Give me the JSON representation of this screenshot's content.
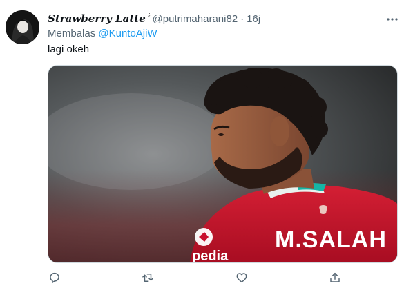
{
  "tweet": {
    "author": {
      "display_name": "Strawberry Latte",
      "name_emoji": "ᵕ̈",
      "handle": "@putrimaharani82",
      "separator": "·",
      "time": "16j"
    },
    "reply_context": {
      "prefix": "Membalas",
      "mention": "@KuntoAjiW"
    },
    "text": "lagi okeh",
    "media": {
      "jersey_name": "M.SALAH",
      "sponsor_text": "pedia"
    },
    "actions": [
      {
        "name": "reply",
        "icon": "reply-icon"
      },
      {
        "name": "retweet",
        "icon": "retweet-icon"
      },
      {
        "name": "like",
        "icon": "heart-icon"
      },
      {
        "name": "share",
        "icon": "share-icon"
      }
    ]
  },
  "colors": {
    "link": "#1d9bf0",
    "secondary_text": "#536471",
    "primary_text": "#0f1419",
    "jersey_red": "#c8102e"
  }
}
